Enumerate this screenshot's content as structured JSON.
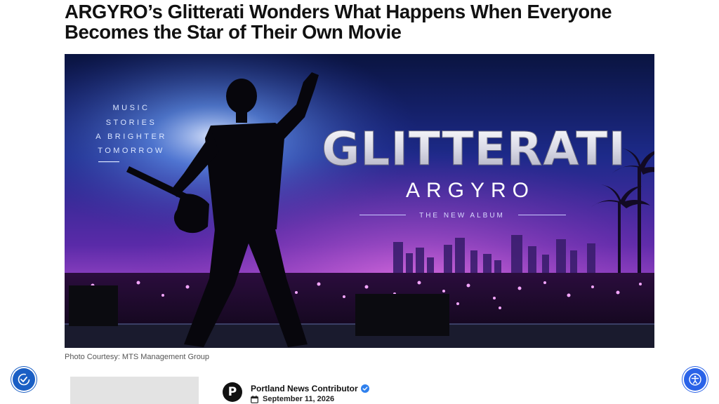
{
  "article": {
    "headline": "ARGYRO’s Glitterati Wonders What Happens When Everyone Becomes the Star of Their Own Movie",
    "caption": "Photo Courtesy: MTS Management Group"
  },
  "hero": {
    "tagline": [
      "MUSIC",
      "STORIES",
      "A BRIGHTER",
      "TOMORROW"
    ],
    "album_title": "GLITTERATI",
    "artist": "ARGYRO",
    "subtitle": "THE NEW ALBUM"
  },
  "author": {
    "initial": "P",
    "name": "Portland News Contributor",
    "date": "September 11, 2026"
  },
  "colors": {
    "accent_blue": "#1a5fc4",
    "accessibility_blue": "#2a63e8",
    "verified_blue": "#2f80ed"
  },
  "icons": {
    "left_float": "accessibility-refresh-icon",
    "right_float": "accessibility-person-icon",
    "verified": "verified-check-icon",
    "date": "calendar-icon"
  }
}
